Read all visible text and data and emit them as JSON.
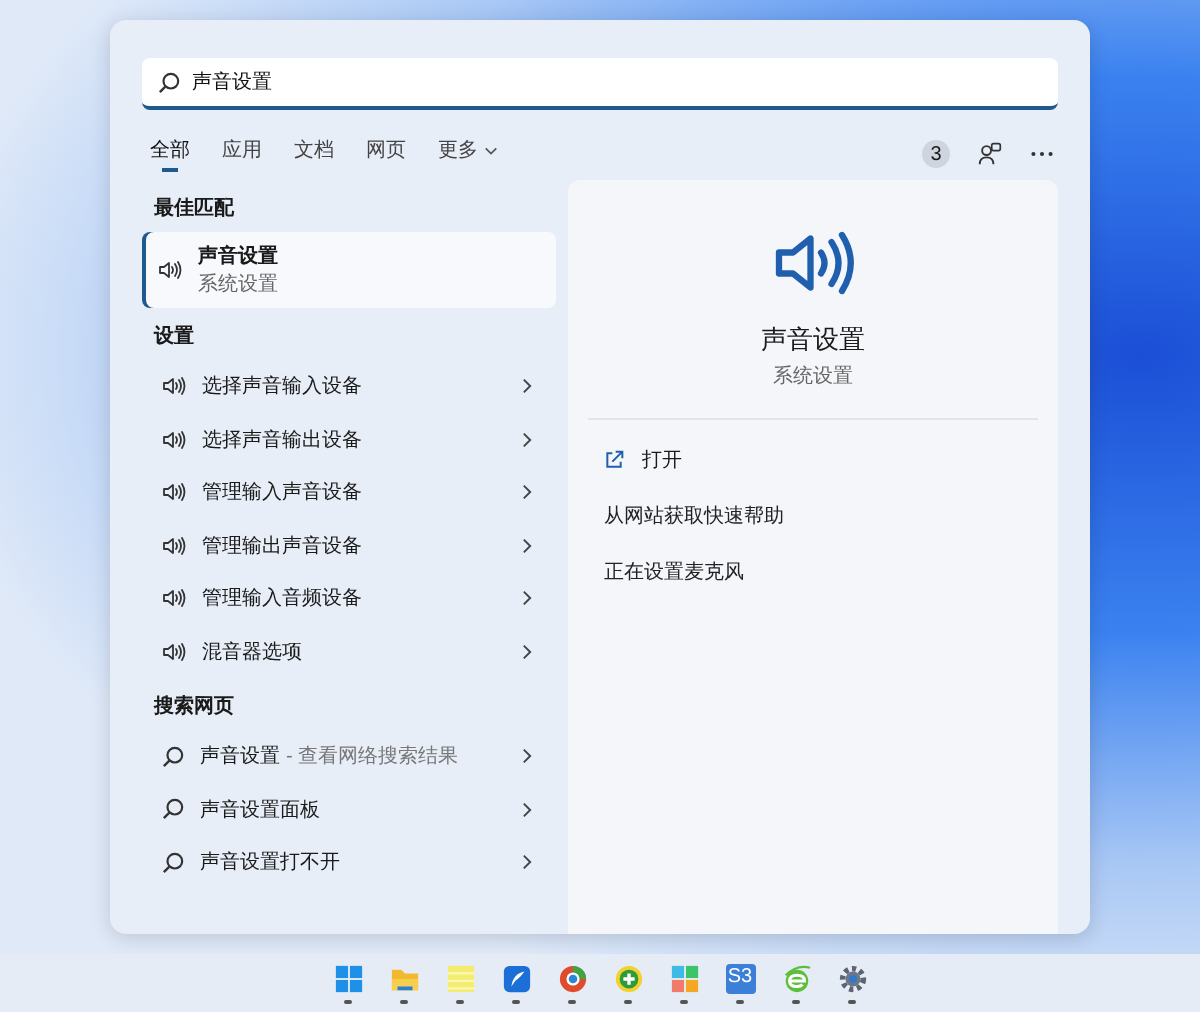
{
  "search": {
    "value": "声音设置"
  },
  "tabs": [
    {
      "label": "全部",
      "selected": true,
      "kind": "tab"
    },
    {
      "label": "应用",
      "selected": false,
      "kind": "tab"
    },
    {
      "label": "文档",
      "selected": false,
      "kind": "tab"
    },
    {
      "label": "网页",
      "selected": false,
      "kind": "tab"
    },
    {
      "label": "更多",
      "selected": false,
      "kind": "menu"
    }
  ],
  "toolbar": {
    "badge": "3"
  },
  "best_match": {
    "heading": "最佳匹配",
    "item": {
      "title": "声音设置",
      "subtitle": "系统设置",
      "selected": true
    }
  },
  "settings": {
    "heading": "设置",
    "items": [
      {
        "label": "选择声音输入设备"
      },
      {
        "label": "选择声音输出设备"
      },
      {
        "label": "管理输入声音设备"
      },
      {
        "label": "管理输出声音设备"
      },
      {
        "label": "管理输入音频设备"
      },
      {
        "label": "混音器选项"
      }
    ]
  },
  "web": {
    "heading": "搜索网页",
    "items": [
      {
        "query": "声音设置",
        "hint": "- 查看网络搜索结果"
      },
      {
        "query": "声音设置面板"
      },
      {
        "query": "声音设置打不开"
      }
    ]
  },
  "detail": {
    "title": "声音设置",
    "subtitle": "系统设置",
    "actions": [
      {
        "label": "打开",
        "kind": "open"
      },
      {
        "label": "从网站获取快速帮助",
        "kind": "link"
      },
      {
        "label": "正在设置麦克风",
        "kind": "link"
      }
    ]
  },
  "taskbar": [
    {
      "kind": "start"
    },
    {
      "kind": "folder"
    },
    {
      "kind": "notes"
    },
    {
      "kind": "feather"
    },
    {
      "kind": "ring"
    },
    {
      "kind": "plus"
    },
    {
      "kind": "tiles"
    },
    {
      "kind": "tile",
      "label": "S3"
    },
    {
      "kind": "e"
    },
    {
      "kind": "gear"
    }
  ]
}
